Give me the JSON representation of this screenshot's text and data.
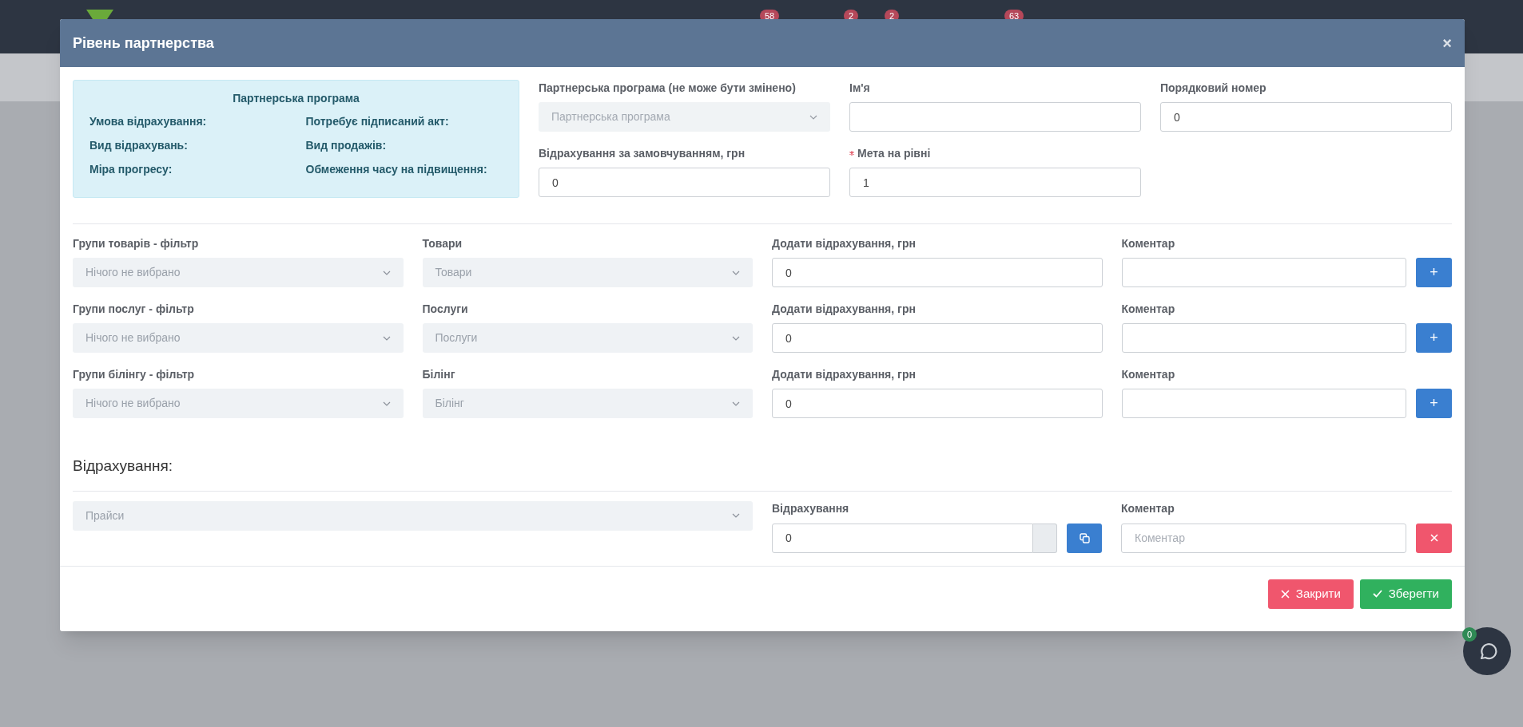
{
  "background": {
    "badges": [
      "58",
      "2",
      "2",
      "63"
    ]
  },
  "modal": {
    "title": "Рівень партнерства",
    "close": "×",
    "info": {
      "title": "Партнерська програма",
      "items": [
        "Умова відрахування:",
        "Потребує підписаний акт:",
        "Вид відрахувань:",
        "Вид продажів:",
        "Міра прогресу:",
        "Обмеження часу на підвищення:"
      ]
    },
    "top_fields": [
      {
        "kind": "select",
        "label": "Партнерська програма (не може бути змінено)",
        "placeholder": "Партнерська програма",
        "disabled": true
      },
      {
        "kind": "input",
        "label": "Ім'я",
        "required": false
      },
      {
        "kind": "input",
        "label": "Порядковий номер",
        "value": "0",
        "required": false
      },
      {
        "kind": "input",
        "label": "Відрахування за замовчуванням, грн",
        "value": "0",
        "required": false
      },
      {
        "kind": "input",
        "label": "Мета на рівні",
        "value": "1",
        "required": true
      }
    ],
    "rows": [
      {
        "filter_label": "Групи товарів - фільтр",
        "filter_placeholder": "Нічого не вибрано",
        "item_label": "Товари",
        "item_placeholder": "Товари",
        "amount_label": "Додати відрахування, грн",
        "amount_value": "0",
        "comment_label": "Коментар",
        "add": "+"
      },
      {
        "filter_label": "Групи послуг - фільтр",
        "filter_placeholder": "Нічого не вибрано",
        "item_label": "Послуги",
        "item_placeholder": "Послуги",
        "amount_label": "Додати відрахування, грн",
        "amount_value": "0",
        "comment_label": "Коментар",
        "add": "+"
      },
      {
        "filter_label": "Групи білінгу - фільтр",
        "filter_placeholder": "Нічого не вибрано",
        "item_label": "Білінг",
        "item_placeholder": "Білінг",
        "amount_label": "Додати відрахування, грн",
        "amount_value": "0",
        "comment_label": "Коментар",
        "add": "+"
      }
    ],
    "section_title": "Відрахування:",
    "deduction": {
      "price_placeholder": "Прайси",
      "amount_label": "Відрахування",
      "amount_value": "0",
      "comment_label": "Коментар",
      "comment_placeholder": "Коментар"
    },
    "footer": {
      "close": "Закрити",
      "save": "Зберегти"
    }
  },
  "chat": {
    "count": "0"
  }
}
